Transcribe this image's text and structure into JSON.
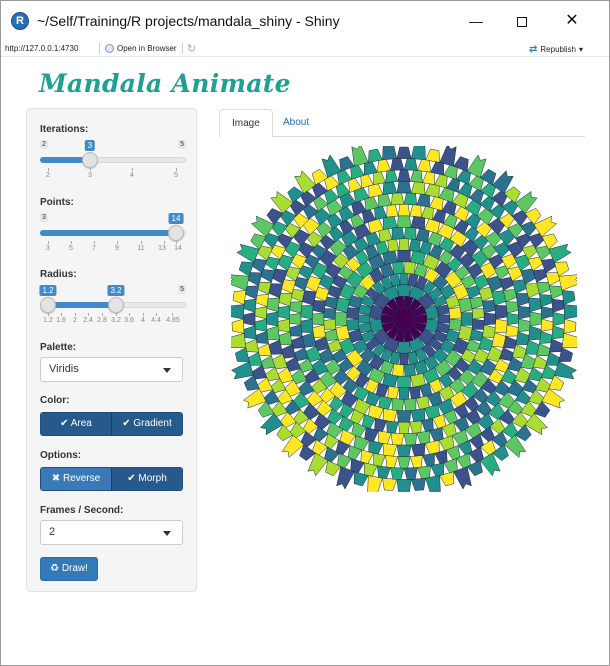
{
  "window": {
    "title": "~/Self/Training/R projects/mandala_shiny - Shiny",
    "minimize_glyph": "—",
    "close_glyph": "✕"
  },
  "toolbar": {
    "url": "http://127.0.0.1:4730",
    "open_in_browser": "Open in Browser",
    "republish": "Republish",
    "republish_caret": "▾"
  },
  "app": {
    "title": "Mandala Animate"
  },
  "sidebar": {
    "iterations": {
      "label": "Iterations:",
      "min": 2,
      "max": 5,
      "value": 3,
      "min_label": "2",
      "max_label": "5",
      "value_label": "3",
      "ticks": [
        "2",
        "3",
        "4",
        "5"
      ]
    },
    "points": {
      "label": "Points:",
      "min": 3,
      "max": 14,
      "value": 14,
      "min_label": "3",
      "max_label": "",
      "value_label": "14",
      "ticks": [
        "3",
        "5",
        "7",
        "9",
        "11",
        "13",
        "14"
      ]
    },
    "radius": {
      "label": "Radius:",
      "min": 1.2,
      "max": 5,
      "value_low": 1.2,
      "value_high": 3.2,
      "min_label": "1.2",
      "max_label": "5",
      "value_label": "3.2",
      "ticks": [
        "1.2",
        "1.6",
        "2",
        "2.4",
        "2.8",
        "3.2",
        "3.6",
        "4",
        "4.4",
        "4.85"
      ]
    },
    "palette": {
      "label": "Palette:",
      "value": "Viridis"
    },
    "color": {
      "label": "Color:",
      "buttons": [
        {
          "icon": "✔",
          "label": "Area"
        },
        {
          "icon": "✔",
          "label": "Gradient"
        }
      ]
    },
    "options": {
      "label": "Options:",
      "buttons": [
        {
          "icon": "✖",
          "label": "Reverse"
        },
        {
          "icon": "✔",
          "label": "Morph"
        }
      ]
    },
    "fps": {
      "label": "Frames / Second:",
      "value": "2"
    },
    "draw": {
      "icon": "♻",
      "label": "Draw!"
    }
  },
  "tabs": [
    {
      "label": "Image",
      "active": true
    },
    {
      "label": "About",
      "active": false
    }
  ],
  "palette_colors": [
    "#440154",
    "#3b528b",
    "#21908d",
    "#5dc863",
    "#fde725",
    "#2c728e",
    "#27ad81",
    "#aadc32"
  ]
}
